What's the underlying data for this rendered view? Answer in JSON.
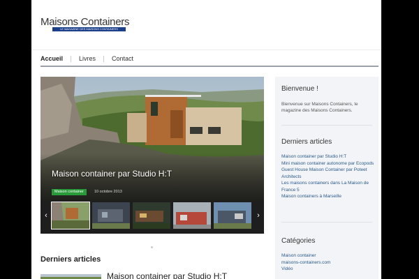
{
  "header": {
    "logo_title": "Maisons Containers",
    "logo_tagline": "LE MAGAZINE DES MAISONS CONTAINERS"
  },
  "nav": {
    "items": [
      {
        "label": "Accueil",
        "active": true
      },
      {
        "label": "Livres",
        "active": false
      },
      {
        "label": "Contact",
        "active": false
      }
    ]
  },
  "slider": {
    "title": "Maison container par Studio H:T",
    "category": "Maison container",
    "date": "10 octobre 2013",
    "prev_icon": "chevron-left-icon",
    "next_icon": "chevron-right-icon",
    "thumb_count": 5
  },
  "sidebar": {
    "welcome": {
      "title": "Bienvenue !",
      "text": "Bienvenue sur Maisons Containers, le magazine des Maisons Containers."
    },
    "recent": {
      "title": "Derniers articles",
      "items": [
        "Maison container par Studio H:T",
        "Mini maison container autonome par Ecopods",
        "Guest House Maison Container par Poteet Architects",
        "Les maisons containers dans La Maison de France 5",
        "Maison containers à Marseille"
      ]
    },
    "categories": {
      "title": "Catégories",
      "items": [
        "Maison container",
        "maisons-containers.com",
        "Vidéo"
      ]
    }
  },
  "main": {
    "latest_title": "Derniers articles",
    "first_post_title": "Maison container par Studio H:T"
  },
  "colors": {
    "background": "#000000",
    "category_badge": "#2a9b3a",
    "link": "#2a5a8c",
    "logo_tag": "#1c3f8c"
  }
}
